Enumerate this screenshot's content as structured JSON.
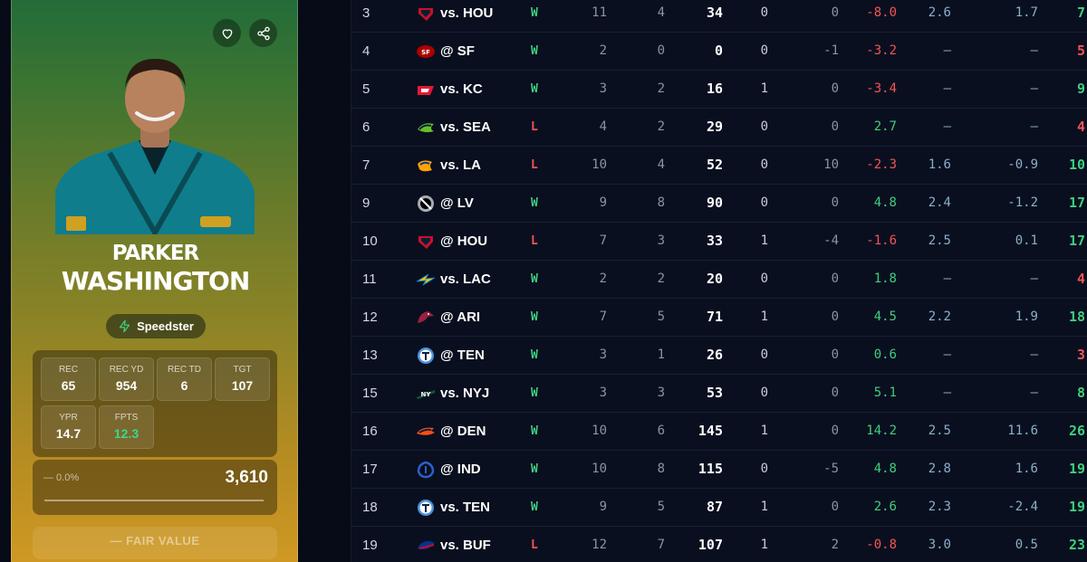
{
  "player": {
    "first_name": "PARKER",
    "last_name": "WASHINGTON",
    "archetype": "Speedster",
    "stats": [
      {
        "label": "REC",
        "value": "65"
      },
      {
        "label": "REC YD",
        "value": "954"
      },
      {
        "label": "REC TD",
        "value": "6"
      },
      {
        "label": "TGT",
        "value": "107"
      },
      {
        "label": "YPR",
        "value": "14.7"
      },
      {
        "label": "FPTS",
        "value": "12.3"
      }
    ],
    "change": "— 0.0%",
    "price": "3,610",
    "fair_value": "— FAIR VALUE"
  },
  "icons": {
    "favorite": "heart-icon",
    "share": "share-icon",
    "archetype": "lightning-bolt-icon"
  },
  "colors": {
    "win": "#3fcf7f",
    "loss": "#f25555",
    "positive": "#3fcf7f",
    "negative": "#f25555",
    "card_top": "#1f6b3a",
    "card_bottom": "#d29a22",
    "table_bg": "#0a0f1f"
  },
  "game_log": [
    {
      "week": "3",
      "team": "HOU",
      "opp": "vs. HOU",
      "res": "W",
      "tgt": "11",
      "rec": "4",
      "yds": "34",
      "td": "0",
      "ra": "0",
      "diff": "-8.0",
      "a": "2.6",
      "b": "1.7",
      "pts": "7"
    },
    {
      "week": "4",
      "team": "SF",
      "opp": "@ SF",
      "res": "W",
      "tgt": "2",
      "rec": "0",
      "yds": "0",
      "td": "0",
      "ra": "-1",
      "diff": "-3.2",
      "a": "—",
      "b": "—",
      "pts": "5"
    },
    {
      "week": "5",
      "team": "KC",
      "opp": "vs. KC",
      "res": "W",
      "tgt": "3",
      "rec": "2",
      "yds": "16",
      "td": "1",
      "ra": "0",
      "diff": "-3.4",
      "a": "—",
      "b": "—",
      "pts": "9"
    },
    {
      "week": "6",
      "team": "SEA",
      "opp": "vs. SEA",
      "res": "L",
      "tgt": "4",
      "rec": "2",
      "yds": "29",
      "td": "0",
      "ra": "0",
      "diff": "2.7",
      "a": "—",
      "b": "—",
      "pts": "4"
    },
    {
      "week": "7",
      "team": "LA",
      "opp": "vs. LA",
      "res": "L",
      "tgt": "10",
      "rec": "4",
      "yds": "52",
      "td": "0",
      "ra": "10",
      "diff": "-2.3",
      "a": "1.6",
      "b": "-0.9",
      "pts": "10"
    },
    {
      "week": "9",
      "team": "LV",
      "opp": "@ LV",
      "res": "W",
      "tgt": "9",
      "rec": "8",
      "yds": "90",
      "td": "0",
      "ra": "0",
      "diff": "4.8",
      "a": "2.4",
      "b": "-1.2",
      "pts": "17"
    },
    {
      "week": "10",
      "team": "HOU",
      "opp": "@ HOU",
      "res": "L",
      "tgt": "7",
      "rec": "3",
      "yds": "33",
      "td": "1",
      "ra": "-4",
      "diff": "-1.6",
      "a": "2.5",
      "b": "0.1",
      "pts": "17"
    },
    {
      "week": "11",
      "team": "LAC",
      "opp": "vs. LAC",
      "res": "W",
      "tgt": "2",
      "rec": "2",
      "yds": "20",
      "td": "0",
      "ra": "0",
      "diff": "1.8",
      "a": "—",
      "b": "—",
      "pts": "4"
    },
    {
      "week": "12",
      "team": "ARI",
      "opp": "@ ARI",
      "res": "W",
      "tgt": "7",
      "rec": "5",
      "yds": "71",
      "td": "1",
      "ra": "0",
      "diff": "4.5",
      "a": "2.2",
      "b": "1.9",
      "pts": "18"
    },
    {
      "week": "13",
      "team": "TEN",
      "opp": "@ TEN",
      "res": "W",
      "tgt": "3",
      "rec": "1",
      "yds": "26",
      "td": "0",
      "ra": "0",
      "diff": "0.6",
      "a": "—",
      "b": "—",
      "pts": "3"
    },
    {
      "week": "15",
      "team": "NYJ",
      "opp": "vs. NYJ",
      "res": "W",
      "tgt": "3",
      "rec": "3",
      "yds": "53",
      "td": "0",
      "ra": "0",
      "diff": "5.1",
      "a": "—",
      "b": "—",
      "pts": "8"
    },
    {
      "week": "16",
      "team": "DEN",
      "opp": "@ DEN",
      "res": "W",
      "tgt": "10",
      "rec": "6",
      "yds": "145",
      "td": "1",
      "ra": "0",
      "diff": "14.2",
      "a": "2.5",
      "b": "11.6",
      "pts": "26"
    },
    {
      "week": "17",
      "team": "IND",
      "opp": "@ IND",
      "res": "W",
      "tgt": "10",
      "rec": "8",
      "yds": "115",
      "td": "0",
      "ra": "-5",
      "diff": "4.8",
      "a": "2.8",
      "b": "1.6",
      "pts": "19"
    },
    {
      "week": "18",
      "team": "TEN",
      "opp": "vs. TEN",
      "res": "W",
      "tgt": "9",
      "rec": "5",
      "yds": "87",
      "td": "1",
      "ra": "0",
      "diff": "2.6",
      "a": "2.3",
      "b": "-2.4",
      "pts": "19"
    },
    {
      "week": "19",
      "team": "BUF",
      "opp": "vs. BUF",
      "res": "L",
      "tgt": "12",
      "rec": "7",
      "yds": "107",
      "td": "1",
      "ra": "2",
      "diff": "-0.8",
      "a": "3.0",
      "b": "0.5",
      "pts": "23"
    }
  ]
}
